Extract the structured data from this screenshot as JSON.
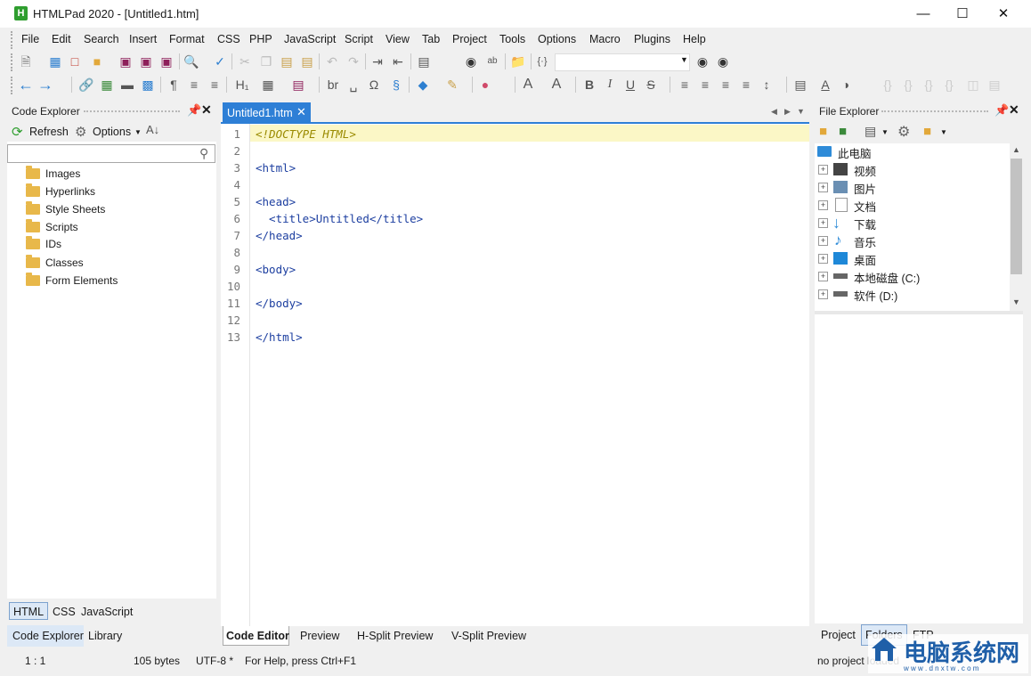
{
  "window": {
    "title": "HTMLPad 2020 - [Untitled1.htm]",
    "logo": "H"
  },
  "menu": [
    "File",
    "Edit",
    "Search",
    "Insert",
    "Format",
    "CSS",
    "PHP",
    "JavaScript",
    "Script",
    "View",
    "Tab",
    "Project",
    "Tools",
    "Options",
    "Macro",
    "Plugins",
    "Help"
  ],
  "code_explorer": {
    "title": "Code Explorer",
    "refresh_label": "Refresh",
    "options_label": "Options",
    "search_value": "",
    "items": [
      "Images",
      "Hyperlinks",
      "Style Sheets",
      "Scripts",
      "IDs",
      "Classes",
      "Form Elements"
    ],
    "lang_tabs": [
      "HTML",
      "CSS",
      "JavaScript"
    ],
    "bottom_tabs": [
      "Code Explorer",
      "Library"
    ]
  },
  "editor": {
    "tab_label": "Untitled1.htm",
    "lines": [
      {
        "n": "1",
        "text": "<!DOCTYPE HTML>"
      },
      {
        "n": "2",
        "text": ""
      },
      {
        "n": "3",
        "text": "<html>"
      },
      {
        "n": "4",
        "text": ""
      },
      {
        "n": "5",
        "text": "<head>"
      },
      {
        "n": "6",
        "text": "  <title>Untitled</title>"
      },
      {
        "n": "7",
        "text": "</head>"
      },
      {
        "n": "8",
        "text": ""
      },
      {
        "n": "9",
        "text": "<body>"
      },
      {
        "n": "10",
        "text": ""
      },
      {
        "n": "11",
        "text": "</body>"
      },
      {
        "n": "12",
        "text": ""
      },
      {
        "n": "13",
        "text": "</html>"
      }
    ],
    "view_tabs": [
      "Code Editor",
      "Preview",
      "H-Split Preview",
      "V-Split Preview"
    ]
  },
  "file_explorer": {
    "title": "File Explorer",
    "root": "此电脑",
    "items": [
      "视频",
      "图片",
      "文档",
      "下载",
      "音乐",
      "桌面",
      "本地磁盘 (C:)",
      "软件 (D:)"
    ],
    "bottom_tabs": [
      "Project",
      "Folders",
      "FTP"
    ]
  },
  "status": {
    "position": "1 : 1",
    "size": "105 bytes",
    "encoding": "UTF-8 *",
    "help": "For Help, press Ctrl+F1",
    "project": "no project loaded"
  },
  "watermark": {
    "text": "电脑系统网",
    "sub": "w w w . d n x t w . c o m"
  }
}
